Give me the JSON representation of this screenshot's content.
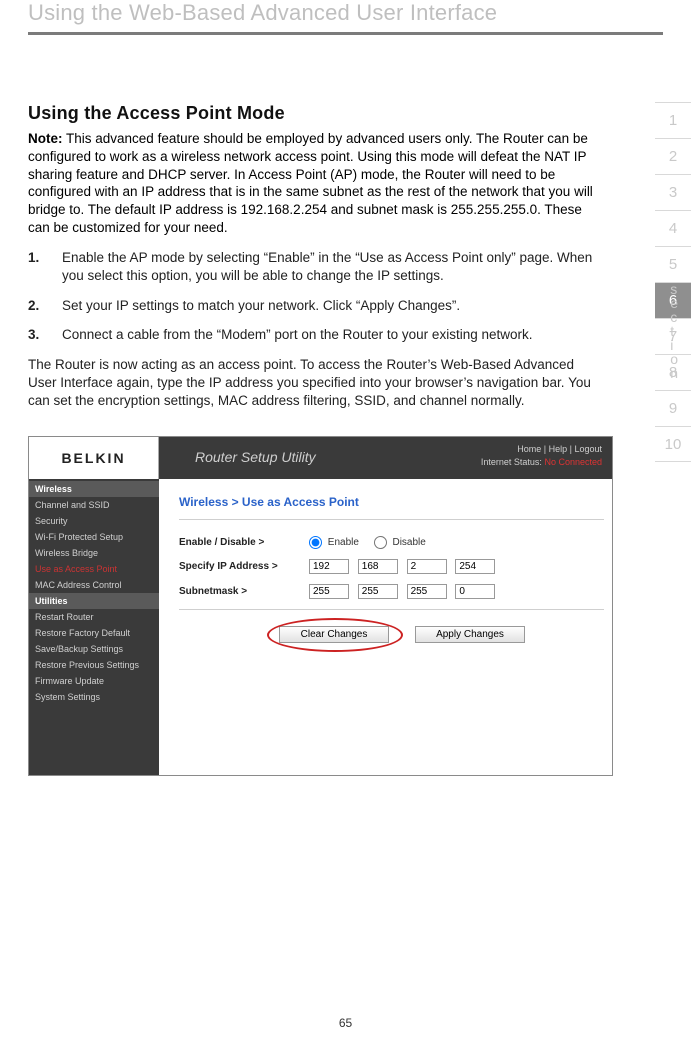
{
  "page": {
    "header_title": "Using the Web-Based Advanced User Interface",
    "number": "65"
  },
  "section_tabs": {
    "label": "section",
    "items": [
      "1",
      "2",
      "3",
      "4",
      "5",
      "6",
      "7",
      "8",
      "9",
      "10"
    ],
    "active_index": 5
  },
  "heading": "Using the Access Point Mode",
  "note_label": "Note:",
  "note_body": "This advanced feature should be employed by advanced users only. The Router can be configured to work as a wireless network access point. Using this mode will defeat the NAT IP sharing feature and DHCP server. In Access Point (AP) mode, the Router will need to be configured with an IP address that is in the same subnet as the rest of the network that you will bridge to. The default IP address is 192.168.2.254 and subnet mask is 255.255.255.0. These can be customized for your need.",
  "steps": [
    {
      "num": "1.",
      "text": "Enable the AP mode by selecting “Enable” in the “Use as Access Point only” page. When you select this option, you will be able to change the IP settings."
    },
    {
      "num": "2.",
      "text": "Set your IP settings to match your network. Click “Apply Changes”."
    },
    {
      "num": "3.",
      "text": "Connect a cable from the “Modem” port on the Router to your existing network."
    }
  ],
  "after_text": "The Router is now acting as an access point. To access the Router’s Web-Based Advanced User Interface again, type the IP address you specified into your browser’s navigation bar. You can set the encryption settings, MAC address filtering, SSID, and channel normally.",
  "router": {
    "logo": "BELKIN",
    "utility_title": "Router Setup Utility",
    "top_links": "Home |  Help | Logout",
    "status_label": "Internet Status:",
    "status_value": "No Connected",
    "sidebar": {
      "groups": [
        {
          "title": "Wireless",
          "items": [
            {
              "label": "Channel and SSID",
              "active": false
            },
            {
              "label": "Security",
              "active": false
            },
            {
              "label": "Wi-Fi Protected Setup",
              "active": false
            },
            {
              "label": "Wireless Bridge",
              "active": false
            },
            {
              "label": "Use as Access Point",
              "active": true
            },
            {
              "label": "MAC Address Control",
              "active": false
            }
          ]
        },
        {
          "title": "Utilities",
          "items": [
            {
              "label": "Restart Router",
              "active": false
            },
            {
              "label": "Restore Factory Default",
              "active": false
            },
            {
              "label": "Save/Backup Settings",
              "active": false
            },
            {
              "label": "Restore Previous Settings",
              "active": false
            },
            {
              "label": "Firmware Update",
              "active": false
            },
            {
              "label": "System Settings",
              "active": false
            }
          ]
        }
      ]
    },
    "breadcrumb": "Wireless > Use as Access Point",
    "form": {
      "enable_label": "Enable / Disable >",
      "enable_option": "Enable",
      "disable_option": "Disable",
      "enable_selected": "Enable",
      "ip_label": "Specify IP Address >",
      "ip": [
        "192",
        "168",
        "2",
        "254"
      ],
      "subnet_label": "Subnetmask >",
      "subnet": [
        "255",
        "255",
        "255",
        "0"
      ],
      "clear_btn": "Clear Changes",
      "apply_btn": "Apply Changes"
    }
  }
}
